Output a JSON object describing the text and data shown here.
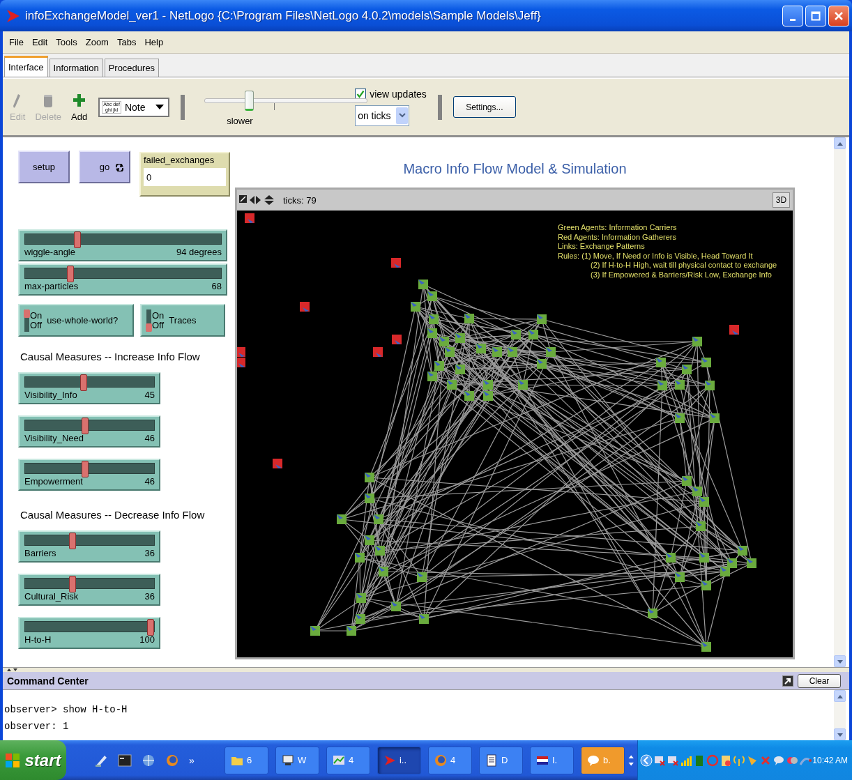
{
  "window": {
    "title": "infoExchangeModel_ver1 - NetLogo {C:\\Program Files\\NetLogo 4.0.2\\models\\Sample Models\\Jeff}"
  },
  "menu": [
    "File",
    "Edit",
    "Tools",
    "Zoom",
    "Tabs",
    "Help"
  ],
  "tabs": [
    {
      "label": "Interface",
      "selected": true
    },
    {
      "label": "Information",
      "selected": false
    },
    {
      "label": "Procedures",
      "selected": false
    }
  ],
  "toolbar": {
    "tools": [
      {
        "kind": "edit",
        "label": "Edit",
        "disabled": true
      },
      {
        "kind": "delete",
        "label": "Delete",
        "disabled": true
      },
      {
        "kind": "add",
        "label": "Add",
        "disabled": false
      }
    ],
    "widget_type": {
      "value": "Note",
      "icon_text": [
        "Abc def",
        "ghi jkl"
      ]
    },
    "speed": {
      "label": "slower",
      "level": 0.26
    },
    "view_updates": {
      "label": "view updates",
      "checked": true
    },
    "update_mode": {
      "value": "on ticks"
    },
    "settings": {
      "label": "Settings..."
    }
  },
  "interface": {
    "title": "Macro Info Flow Model & Simulation",
    "buttons": [
      {
        "label": "setup",
        "forever": false
      },
      {
        "label": "go",
        "forever": true
      }
    ],
    "monitor": {
      "label": "failed_exchanges",
      "value": "0"
    },
    "widgets": [
      {
        "kind": "slider",
        "label": "wiggle-angle",
        "reading": "94 degrees",
        "level": 0.26
      },
      {
        "kind": "slider",
        "label": "max-particles",
        "reading": "68",
        "level": 0.22
      },
      {
        "kind": "switches",
        "items": [
          {
            "label": "use-whole-world?",
            "on_text": "On",
            "off_text": "Off",
            "on": true
          },
          {
            "label": "Traces",
            "on_text": "On",
            "off_text": "Off",
            "on": false
          }
        ]
      },
      {
        "kind": "note",
        "text": "Causal Measures -- Increase Info Flow"
      },
      {
        "kind": "slider",
        "label": "Visibility_Info",
        "reading": "45",
        "level": 0.45
      },
      {
        "kind": "slider",
        "label": "Visibility_Need",
        "reading": "46",
        "level": 0.46
      },
      {
        "kind": "slider",
        "label": "Empowerment",
        "reading": "46",
        "level": 0.46
      },
      {
        "kind": "note",
        "text": "Causal Measures -- Decrease Info Flow"
      },
      {
        "kind": "slider",
        "label": "Barriers",
        "reading": "36",
        "level": 0.36
      },
      {
        "kind": "slider",
        "label": "Cultural_Risk",
        "reading": "36",
        "level": 0.36
      },
      {
        "kind": "slider",
        "label": "H-to-H",
        "reading": "100",
        "level": 1
      }
    ],
    "view": {
      "ticks": "ticks: 79",
      "three_d": "3D",
      "legend": [
        {
          "text": "Green Agents: Information Carriers",
          "indent": false
        },
        {
          "text": "Red Agents: Information Gatherers",
          "indent": false
        },
        {
          "text": "Links: Exchange Patterns",
          "indent": false
        },
        {
          "text": "Rules: (1) Move, If Need or Info is Visible, Head Toward It",
          "indent": false
        },
        {
          "text": "(2) If H-to-H High, wait till physical contact to exchange",
          "indent": true
        },
        {
          "text": "(3) If Empowered & Barriers/Risk Low, Exchange Info",
          "indent": true
        }
      ]
    }
  },
  "command_center": {
    "title": "Command Center",
    "clear": "Clear",
    "lines": [
      "observer> show H-to-H",
      "observer: 1"
    ]
  },
  "taskbar": {
    "start": "start",
    "chevron": "»",
    "tasks": [
      {
        "kind": "folder",
        "label": "6",
        "selected": false,
        "attention": false
      },
      {
        "kind": "computer",
        "label": "W",
        "selected": false,
        "attention": false
      },
      {
        "kind": "chart",
        "label": "4",
        "selected": false,
        "attention": false
      },
      {
        "kind": "netlogo",
        "label": "i..",
        "selected": true,
        "attention": false
      },
      {
        "kind": "firefox",
        "label": "4",
        "selected": false,
        "attention": false
      },
      {
        "kind": "document",
        "label": "D",
        "selected": false,
        "attention": false
      },
      {
        "kind": "flag",
        "label": "I.",
        "selected": false,
        "attention": false
      },
      {
        "kind": "chat",
        "label": "b.",
        "selected": false,
        "attention": true
      }
    ],
    "clock": "10:42 AM"
  }
}
